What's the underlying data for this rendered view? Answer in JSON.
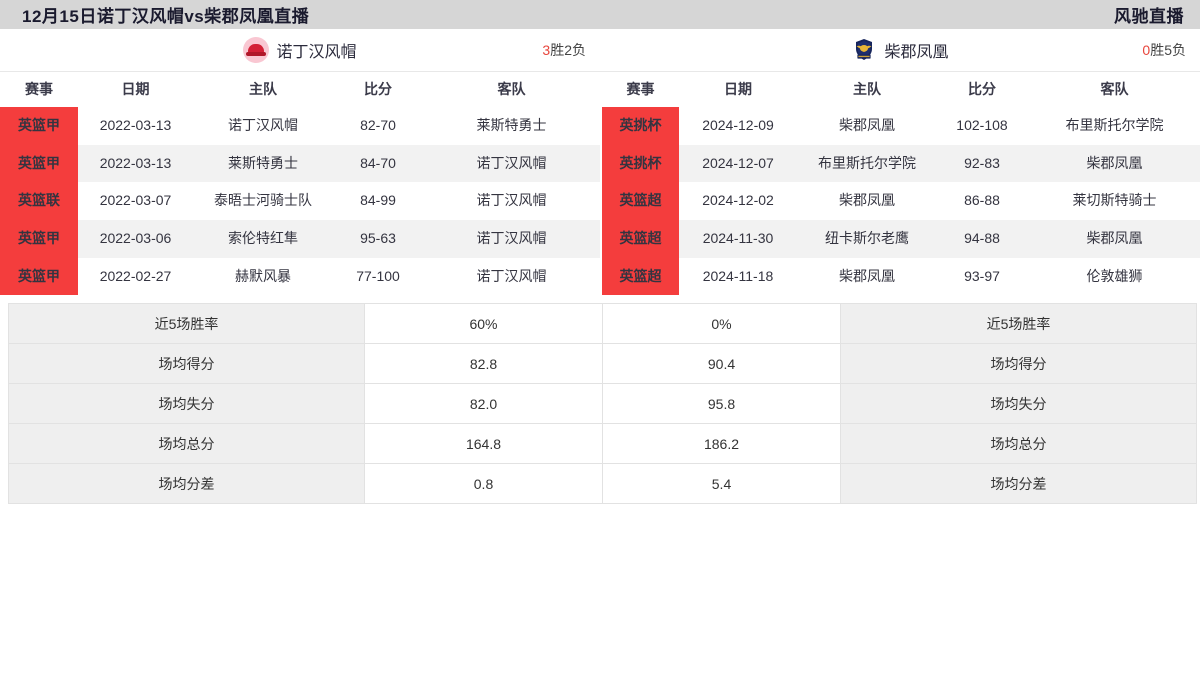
{
  "topbar": {
    "title": "12月15日诺丁汉风帽vs柴郡凤凰直播",
    "brand": "风驰直播"
  },
  "teams": {
    "home": {
      "name": "诺丁汉风帽",
      "logo_icon": "nottingham-hoods-logo-icon",
      "record": "3胜2负",
      "record_wins": "3",
      "record_win_label": "胜",
      "record_losses": "2",
      "record_loss_label": "负"
    },
    "away": {
      "name": "柴郡凤凰",
      "logo_icon": "cheshire-phoenix-logo-icon",
      "record": "0胜5负",
      "record_wins": "0",
      "record_win_label": "胜",
      "record_losses": "5",
      "record_loss_label": "负"
    }
  },
  "match_table": {
    "headers": [
      "赛事",
      "日期",
      "主队",
      "比分",
      "客队"
    ],
    "home_rows": [
      {
        "league": "英篮甲",
        "date": "2022-03-13",
        "home": "诺丁汉风帽",
        "score": "82-70",
        "away": "莱斯特勇士"
      },
      {
        "league": "英篮甲",
        "date": "2022-03-13",
        "home": "莱斯特勇士",
        "score": "84-70",
        "away": "诺丁汉风帽"
      },
      {
        "league": "英篮联",
        "date": "2022-03-07",
        "home": "泰晤士河骑士队",
        "score": "84-99",
        "away": "诺丁汉风帽"
      },
      {
        "league": "英篮甲",
        "date": "2022-03-06",
        "home": "索伦特红隼",
        "score": "95-63",
        "away": "诺丁汉风帽"
      },
      {
        "league": "英篮甲",
        "date": "2022-02-27",
        "home": "赫默风暴",
        "score": "77-100",
        "away": "诺丁汉风帽"
      }
    ],
    "away_rows": [
      {
        "league": "英挑杯",
        "date": "2024-12-09",
        "home": "柴郡凤凰",
        "score": "102-108",
        "away": "布里斯托尔学院"
      },
      {
        "league": "英挑杯",
        "date": "2024-12-07",
        "home": "布里斯托尔学院",
        "score": "92-83",
        "away": "柴郡凤凰"
      },
      {
        "league": "英篮超",
        "date": "2024-12-02",
        "home": "柴郡凤凰",
        "score": "86-88",
        "away": "莱切斯特骑士"
      },
      {
        "league": "英篮超",
        "date": "2024-11-30",
        "home": "纽卡斯尔老鹰",
        "score": "94-88",
        "away": "柴郡凤凰"
      },
      {
        "league": "英篮超",
        "date": "2024-11-18",
        "home": "柴郡凤凰",
        "score": "93-97",
        "away": "伦敦雄狮"
      }
    ]
  },
  "stats": {
    "rows": [
      {
        "label_left": "近5场胜率",
        "value_left": "60%",
        "value_right": "0%",
        "label_right": "近5场胜率"
      },
      {
        "label_left": "场均得分",
        "value_left": "82.8",
        "value_right": "90.4",
        "label_right": "场均得分"
      },
      {
        "label_left": "场均失分",
        "value_left": "82.0",
        "value_right": "95.8",
        "label_right": "场均失分"
      },
      {
        "label_left": "场均总分",
        "value_left": "164.8",
        "value_right": "186.2",
        "label_right": "场均总分"
      },
      {
        "label_left": "场均分差",
        "value_left": "0.8",
        "value_right": "5.4",
        "label_right": "场均分差"
      }
    ]
  },
  "colors": {
    "badge_red": "#f43d3d",
    "topbar_bg": "#d6d6d6",
    "row_alt": "#f2f2f2",
    "stats_label_bg": "#efefef",
    "record_accent": "#e8453c"
  }
}
